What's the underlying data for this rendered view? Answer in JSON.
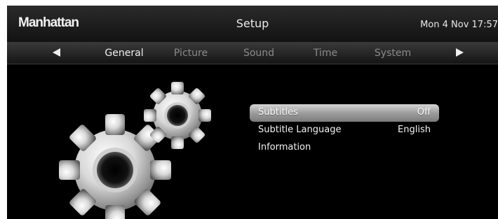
{
  "header": {
    "logo": "Manhattan",
    "title": "Setup",
    "clock": "Mon 4 Nov 17:57"
  },
  "tabs": {
    "prev_icon": "left-arrow-icon",
    "next_icon": "right-arrow-icon",
    "items": [
      {
        "label": "General",
        "active": true
      },
      {
        "label": "Picture",
        "active": false
      },
      {
        "label": "Sound",
        "active": false
      },
      {
        "label": "Time",
        "active": false
      },
      {
        "label": "System",
        "active": false
      }
    ]
  },
  "illustration": {
    "icon": "gears-icon"
  },
  "menu": {
    "items": [
      {
        "label": "Subtitles",
        "value": "Off",
        "selected": true
      },
      {
        "label": "Subtitle Language",
        "value": "English",
        "selected": false
      },
      {
        "label": "Information",
        "value": "",
        "selected": false
      }
    ]
  },
  "colors": {
    "background": "#000000",
    "active_tab": "#f0f0f0",
    "inactive_tab": "#8a8a8a",
    "highlight": "#9d9d9d"
  }
}
